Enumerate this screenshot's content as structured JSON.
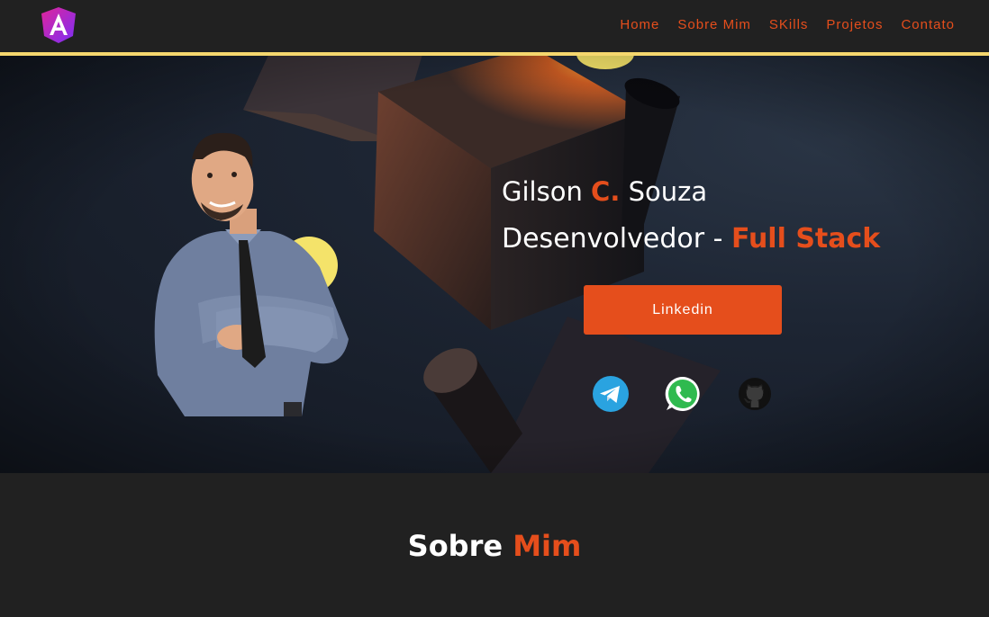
{
  "nav": {
    "logo_icon": "angular-logo-icon",
    "links": [
      "Home",
      "Sobre Mim",
      "SKills",
      "Projetos",
      "Contato"
    ]
  },
  "hero": {
    "name_first": "Gilson ",
    "name_middle": "C.",
    "name_last": " Souza",
    "role_prefix": "Desenvolvedor - ",
    "role_highlight": "Full Stack",
    "linkedin_label": "Linkedin",
    "avatar": "avatar-3d-man-icon",
    "socials": [
      "telegram-icon",
      "whatsapp-icon",
      "github-icon"
    ]
  },
  "about": {
    "title": "Sobre ",
    "title_highlight": "Mim"
  },
  "colors": {
    "accent": "#e54e1c",
    "nav_line": "#f5d76e",
    "background": "#212121"
  }
}
